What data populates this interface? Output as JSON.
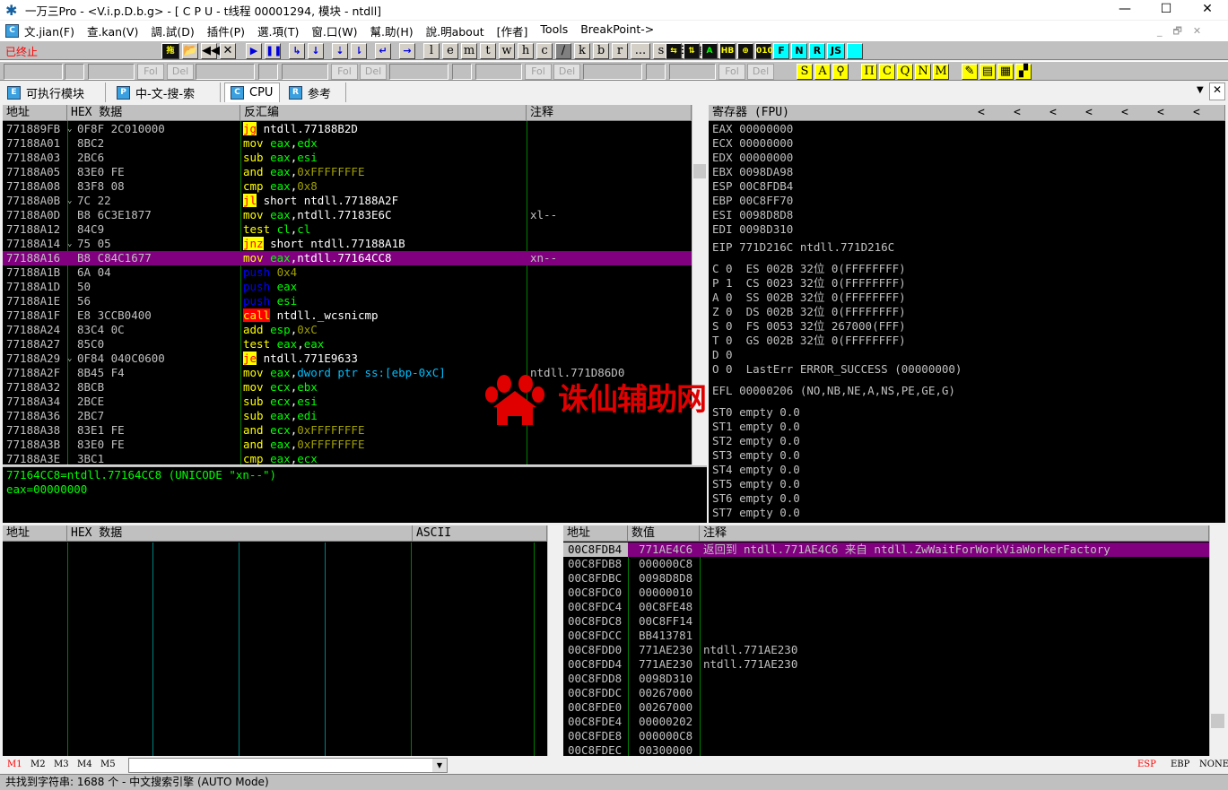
{
  "window": {
    "title": "一万三Pro - <V.i.p.D.b.g> - [ C P U  - t线程  00001294, 模块 - ntdll]",
    "minimize": "—",
    "maximize": "☐",
    "close": "✕"
  },
  "menu": {
    "mdi_icon": "C",
    "items": [
      "文.jian(F)",
      "查.kan(V)",
      "調.試(D)",
      "插件(P)",
      "選.項(T)",
      "窗.口(W)",
      "幫.助(H)",
      "說.明about",
      "[作者]",
      "Tools",
      "BreakPoint->"
    ],
    "mdi_controls": [
      "_",
      "🗗",
      "✕"
    ]
  },
  "toolbar": {
    "status": "已终止",
    "status_color": "#ff0000",
    "buttons": [
      "拖",
      "open",
      "◀◀",
      "✕",
      "▶",
      "❚❚",
      "step-into",
      "step-over",
      "trace-into",
      "trace-over",
      "execute-till-return",
      "goto",
      "l",
      "e",
      "m",
      "t",
      "w",
      "h",
      "c",
      "/",
      "k",
      "b",
      "r",
      "...",
      "s",
      "list",
      "colors",
      "?"
    ],
    "buttons_right": [
      "swap",
      "up-down",
      "A",
      "HB",
      "target",
      "0101",
      "F",
      "N",
      "R",
      "JS",
      ""
    ]
  },
  "toolbar2": {
    "fol": "Fol",
    "del": "Del",
    "yellow_buttons": [
      "S",
      "A",
      "pin",
      "Π",
      "C",
      "Q",
      "N",
      "M",
      "brush",
      "note",
      "calc",
      "grid"
    ]
  },
  "tabs": [
    {
      "icon": "E",
      "label": "可执行模块"
    },
    {
      "icon": "P",
      "label": "中-文-搜-索"
    },
    {
      "icon": "C",
      "label": "CPU",
      "active": true
    },
    {
      "icon": "R",
      "label": "参考"
    }
  ],
  "tabs_controls": {
    "dropdown": "▼",
    "close": "✕"
  },
  "disasm": {
    "headers": [
      "地址",
      "HEX 数据",
      "反汇编",
      "注释"
    ],
    "rows": [
      {
        "addr": "771889FB",
        "hex": "0F8F 2C010000",
        "jmp": true,
        "mn": "jg",
        "mt": "jcc",
        "ops": [
          [
            " ntdll.77188B2D",
            "txt"
          ]
        ],
        "cm": ""
      },
      {
        "addr": "77188A01",
        "hex": "8BC2",
        "mn": "mov",
        "mt": "mov",
        "ops": [
          [
            " eax",
            "reg"
          ],
          [
            ",",
            "txt"
          ],
          [
            "edx",
            "reg"
          ]
        ],
        "cm": ""
      },
      {
        "addr": "77188A03",
        "hex": "2BC6",
        "mn": "sub",
        "mt": "mov",
        "ops": [
          [
            " eax",
            "reg"
          ],
          [
            ",",
            "txt"
          ],
          [
            "esi",
            "reg"
          ]
        ],
        "cm": ""
      },
      {
        "addr": "77188A05",
        "hex": "83E0 FE",
        "mn": "and",
        "mt": "mov",
        "ops": [
          [
            " eax",
            "reg"
          ],
          [
            ",",
            "txt"
          ],
          [
            "0xFFFFFFFE",
            "const"
          ]
        ],
        "cm": ""
      },
      {
        "addr": "77188A08",
        "hex": "83F8 08",
        "mn": "cmp",
        "mt": "mov",
        "ops": [
          [
            " eax",
            "reg"
          ],
          [
            ",",
            "txt"
          ],
          [
            "0x8",
            "const"
          ]
        ],
        "cm": ""
      },
      {
        "addr": "77188A0B",
        "hex": "7C 22",
        "jmp": true,
        "mn": "jl",
        "mt": "jcc",
        "ops": [
          [
            " short ntdll.77188A2F",
            "txt"
          ]
        ],
        "cm": ""
      },
      {
        "addr": "77188A0D",
        "hex": "B8 6C3E1877",
        "mn": "mov",
        "mt": "mov",
        "ops": [
          [
            " eax",
            "reg"
          ],
          [
            ",ntdll.77183E6C",
            "txt"
          ]
        ],
        "cm": "xl--"
      },
      {
        "addr": "77188A12",
        "hex": "84C9",
        "mn": "test",
        "mt": "mov",
        "ops": [
          [
            " cl",
            "reg"
          ],
          [
            ",",
            "txt"
          ],
          [
            "cl",
            "reg"
          ]
        ],
        "cm": ""
      },
      {
        "addr": "77188A14",
        "hex": "75 05",
        "jmp": true,
        "mn": "jnz",
        "mt": "jcc",
        "ops": [
          [
            " short ntdll.77188A1B",
            "txt"
          ]
        ],
        "cm": ""
      },
      {
        "addr": "77188A16",
        "hex": "B8 C84C1677",
        "sel": true,
        "mn": "mov",
        "mt": "mov",
        "ops": [
          [
            " eax",
            "reg"
          ],
          [
            ",ntdll.77164CC8",
            "txt"
          ]
        ],
        "cm": "xn--"
      },
      {
        "addr": "77188A1B",
        "hex": "6A 04",
        "mn": "push",
        "mt": "push",
        "ops": [
          [
            " 0x4",
            "const"
          ]
        ],
        "cm": ""
      },
      {
        "addr": "77188A1D",
        "hex": "50",
        "mn": "push",
        "mt": "push",
        "ops": [
          [
            " eax",
            "reg"
          ]
        ],
        "cm": ""
      },
      {
        "addr": "77188A1E",
        "hex": "56",
        "mn": "push",
        "mt": "push",
        "ops": [
          [
            " esi",
            "reg"
          ]
        ],
        "cm": ""
      },
      {
        "addr": "77188A1F",
        "hex": "E8 3CCB0400",
        "mn": "call",
        "mt": "call",
        "ops": [
          [
            " ntdll._wcsnicmp",
            "txt"
          ]
        ],
        "cm": ""
      },
      {
        "addr": "77188A24",
        "hex": "83C4 0C",
        "mn": "add",
        "mt": "mov",
        "ops": [
          [
            " esp",
            "reg"
          ],
          [
            ",",
            "txt"
          ],
          [
            "0xC",
            "const"
          ]
        ],
        "cm": ""
      },
      {
        "addr": "77188A27",
        "hex": "85C0",
        "mn": "test",
        "mt": "mov",
        "ops": [
          [
            " eax",
            "reg"
          ],
          [
            ",",
            "txt"
          ],
          [
            "eax",
            "reg"
          ]
        ],
        "cm": ""
      },
      {
        "addr": "77188A29",
        "hex": "0F84 040C0600",
        "jmp": true,
        "mn": "je",
        "mt": "jcc",
        "ops": [
          [
            " ntdll.771E9633",
            "txt"
          ]
        ],
        "cm": ""
      },
      {
        "addr": "77188A2F",
        "hex": "8B45 F4",
        "mn": "mov",
        "mt": "mov",
        "ops": [
          [
            " eax",
            "reg"
          ],
          [
            ",",
            "txt"
          ],
          [
            "dword ptr ss:[ebp-0xC]",
            "mem"
          ]
        ],
        "cm": "ntdll.771D86D0"
      },
      {
        "addr": "77188A32",
        "hex": "8BCB",
        "mn": "mov",
        "mt": "mov",
        "ops": [
          [
            " ecx",
            "reg"
          ],
          [
            ",",
            "txt"
          ],
          [
            "ebx",
            "reg"
          ]
        ],
        "cm": ""
      },
      {
        "addr": "77188A34",
        "hex": "2BCE",
        "mn": "sub",
        "mt": "mov",
        "ops": [
          [
            " ecx",
            "reg"
          ],
          [
            ",",
            "txt"
          ],
          [
            "esi",
            "reg"
          ]
        ],
        "cm": ""
      },
      {
        "addr": "77188A36",
        "hex": "2BC7",
        "mn": "sub",
        "mt": "mov",
        "ops": [
          [
            " eax",
            "reg"
          ],
          [
            ",",
            "txt"
          ],
          [
            "edi",
            "reg"
          ]
        ],
        "cm": ""
      },
      {
        "addr": "77188A38",
        "hex": "83E1 FE",
        "mn": "and",
        "mt": "mov",
        "ops": [
          [
            " ecx",
            "reg"
          ],
          [
            ",",
            "txt"
          ],
          [
            "0xFFFFFFFE",
            "const"
          ]
        ],
        "cm": ""
      },
      {
        "addr": "77188A3B",
        "hex": "83E0 FE",
        "mn": "and",
        "mt": "mov",
        "ops": [
          [
            " eax",
            "reg"
          ],
          [
            ",",
            "txt"
          ],
          [
            "0xFFFFFFFE",
            "const"
          ]
        ],
        "cm": ""
      },
      {
        "addr": "77188A3E",
        "hex": "3BC1",
        "mn": "cmp",
        "mt": "mov",
        "ops": [
          [
            " eax",
            "reg"
          ],
          [
            ",",
            "txt"
          ],
          [
            "ecx",
            "reg"
          ]
        ],
        "cm": ""
      }
    ],
    "jump_arrow": "⌄"
  },
  "info": {
    "lines": [
      "77164CC8=ntdll.77164CC8 (UNICODE \"xn--\")",
      "eax=00000000"
    ]
  },
  "registers": {
    "header": "寄存器 (FPU)",
    "nav": "<",
    "gpr": [
      "EAX 00000000",
      "ECX 00000000",
      "EDX 00000000",
      "EBX 0098DA98",
      "ESP 00C8FDB4",
      "EBP 00C8FF70",
      "ESI 0098D8D8",
      "EDI 0098D310"
    ],
    "eip": "EIP 771D216C ntdll.771D216C",
    "flags": [
      "C 0  ES 002B 32位 0(FFFFFFFF)",
      "P 1  CS 0023 32位 0(FFFFFFFF)",
      "A 0  SS 002B 32位 0(FFFFFFFF)",
      "Z 0  DS 002B 32位 0(FFFFFFFF)",
      "S 0  FS 0053 32位 267000(FFF)",
      "T 0  GS 002B 32位 0(FFFFFFFF)",
      "D 0",
      "O 0  LastErr ERROR_SUCCESS (00000000)"
    ],
    "efl": "EFL 00000206 (NO,NB,NE,A,NS,PE,GE,G)",
    "fpu": [
      "ST0 empty 0.0",
      "ST1 empty 0.0",
      "ST2 empty 0.0",
      "ST3 empty 0.0",
      "ST4 empty 0.0",
      "ST5 empty 0.0",
      "ST6 empty 0.0",
      "ST7 empty 0.0"
    ]
  },
  "dump": {
    "headers": [
      "地址",
      "HEX 数据",
      "ASCII"
    ]
  },
  "stack": {
    "headers": [
      "地址",
      "数值",
      "注释"
    ],
    "rows": [
      {
        "addr": "00C8FDB4",
        "val": "771AE4C6",
        "cm": "返回到 ntdll.771AE4C6 来自 ntdll.ZwWaitForWorkViaWorkerFactory",
        "sel": true
      },
      {
        "addr": "00C8FDB8",
        "val": "000000C8",
        "cm": ""
      },
      {
        "addr": "00C8FDBC",
        "val": "0098D8D8",
        "cm": ""
      },
      {
        "addr": "00C8FDC0",
        "val": "00000010",
        "cm": ""
      },
      {
        "addr": "00C8FDC4",
        "val": "00C8FE48",
        "cm": ""
      },
      {
        "addr": "00C8FDC8",
        "val": "00C8FF14",
        "cm": ""
      },
      {
        "addr": "00C8FDCC",
        "val": "BB413781",
        "cm": ""
      },
      {
        "addr": "00C8FDD0",
        "val": "771AE230",
        "cm": "ntdll.771AE230"
      },
      {
        "addr": "00C8FDD4",
        "val": "771AE230",
        "cm": "ntdll.771AE230"
      },
      {
        "addr": "00C8FDD8",
        "val": "0098D310",
        "cm": ""
      },
      {
        "addr": "00C8FDDC",
        "val": "00267000",
        "cm": ""
      },
      {
        "addr": "00C8FDE0",
        "val": "00267000",
        "cm": ""
      },
      {
        "addr": "00C8FDE4",
        "val": "00000202",
        "cm": ""
      },
      {
        "addr": "00C8FDE8",
        "val": "000000C8",
        "cm": ""
      },
      {
        "addr": "00C8FDEC",
        "val": "00300000",
        "cm": ""
      }
    ]
  },
  "bottom": {
    "mtabs": [
      "M1",
      "M2",
      "M3",
      "M4",
      "M5"
    ],
    "combo_value": "",
    "combo_arrow": "▼",
    "stack_modes": [
      "ESP",
      "EBP",
      "NONE"
    ]
  },
  "status": "共找到字符串: 1688 个  -  中文搜索引擎 (AUTO Mode)",
  "watermark": {
    "text": "诛仙辅助网",
    "color": "#e00000"
  }
}
